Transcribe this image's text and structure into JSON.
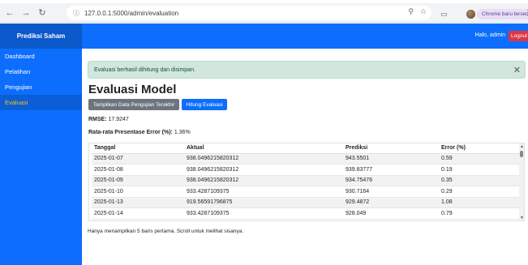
{
  "browser": {
    "url": "127.0.0.1:5000/admin/evaluation",
    "update_label": "Chrome baru tersedia"
  },
  "navbar": {
    "brand": "Prediksi Saham",
    "greeting": "Halo, admin",
    "logout_label": "Logout"
  },
  "sidebar": {
    "items": [
      {
        "label": "Dashboard"
      },
      {
        "label": "Pelatihan"
      },
      {
        "label": "Pengujian"
      },
      {
        "label": "Evaluasi"
      }
    ]
  },
  "main": {
    "alert": "Evaluasi berhasil dihitung dan disimpan.",
    "title": "Evaluasi Model",
    "btn_show": "Tampilkan Data Pengujian Terakhir",
    "btn_compute": "Hitung Evaluasi",
    "rmse_label": "RMSE:",
    "rmse_value": "17.9247",
    "error_label": "Rata-rata Presentase Error (%):",
    "error_value": "1.36%",
    "table": {
      "headers": [
        "Tanggal",
        "Aktual",
        "Prediksi",
        "Error (%)"
      ],
      "rows": [
        [
          "2025-01-07",
          "938.0496215820312",
          "943.5501",
          "0.59"
        ],
        [
          "2025-01-08",
          "938.0496215820312",
          "939.83777",
          "0.19"
        ],
        [
          "2025-01-09",
          "938.0496215820312",
          "934.75476",
          "0.35"
        ],
        [
          "2025-01-10",
          "933.4287109375",
          "930.7164",
          "0.29"
        ],
        [
          "2025-01-13",
          "919.56591796875",
          "929.4872",
          "1.08"
        ],
        [
          "2025-01-14",
          "933.4287109375",
          "928.049",
          "0.79"
        ]
      ]
    },
    "note": "Hanya menampilkan 5 baris pertama. Scroll untuk melihat sisanya."
  }
}
